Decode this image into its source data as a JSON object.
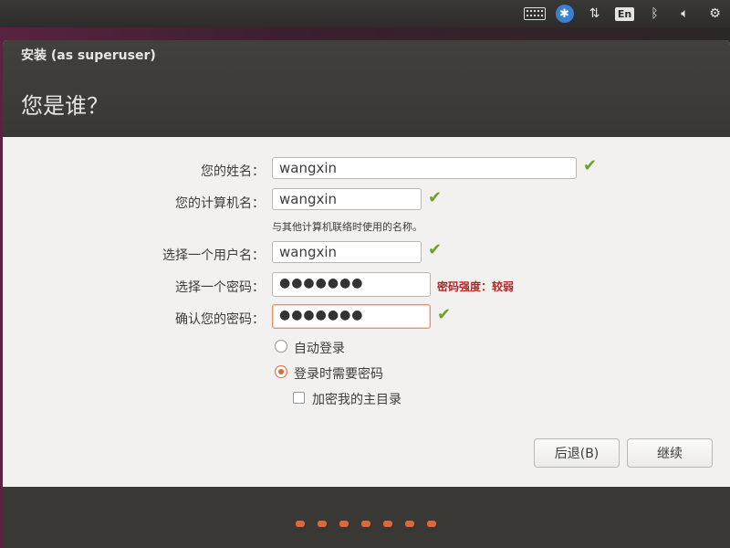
{
  "tray": {
    "keyboard_icon": "keyboard-icon",
    "accessibility_icon": "accessibility-icon",
    "network_icon": "network-updown-icon",
    "language": "En",
    "bluetooth_icon": "bluetooth-icon",
    "volume_icon": "volume-icon",
    "settings_icon": "gear-icon"
  },
  "window": {
    "title": "安装 (as superuser)",
    "heading": "您是谁？"
  },
  "form": {
    "name_label": "您的姓名：",
    "name_value": "wangxin",
    "computer_label": "您的计算机名：",
    "computer_value": "wangxin",
    "computer_hint": "与其他计算机联络时使用的名称。",
    "username_label": "选择一个用户名：",
    "username_value": "wangxin",
    "password_label": "选择一个密码：",
    "password_value": "●●●●●●●",
    "password_strength": "密码强度：较弱",
    "confirm_label": "确认您的密码：",
    "confirm_value": "●●●●●●●",
    "check_mark": "✔"
  },
  "login_options": {
    "auto_login": "自动登录",
    "require_password": "登录时需要密码",
    "encrypt_home": "加密我的主目录",
    "selected": "require_password"
  },
  "buttons": {
    "back": "后退(B)",
    "continue": "继续"
  },
  "progress": {
    "dot_count": 7,
    "accent": "#e0693a"
  }
}
